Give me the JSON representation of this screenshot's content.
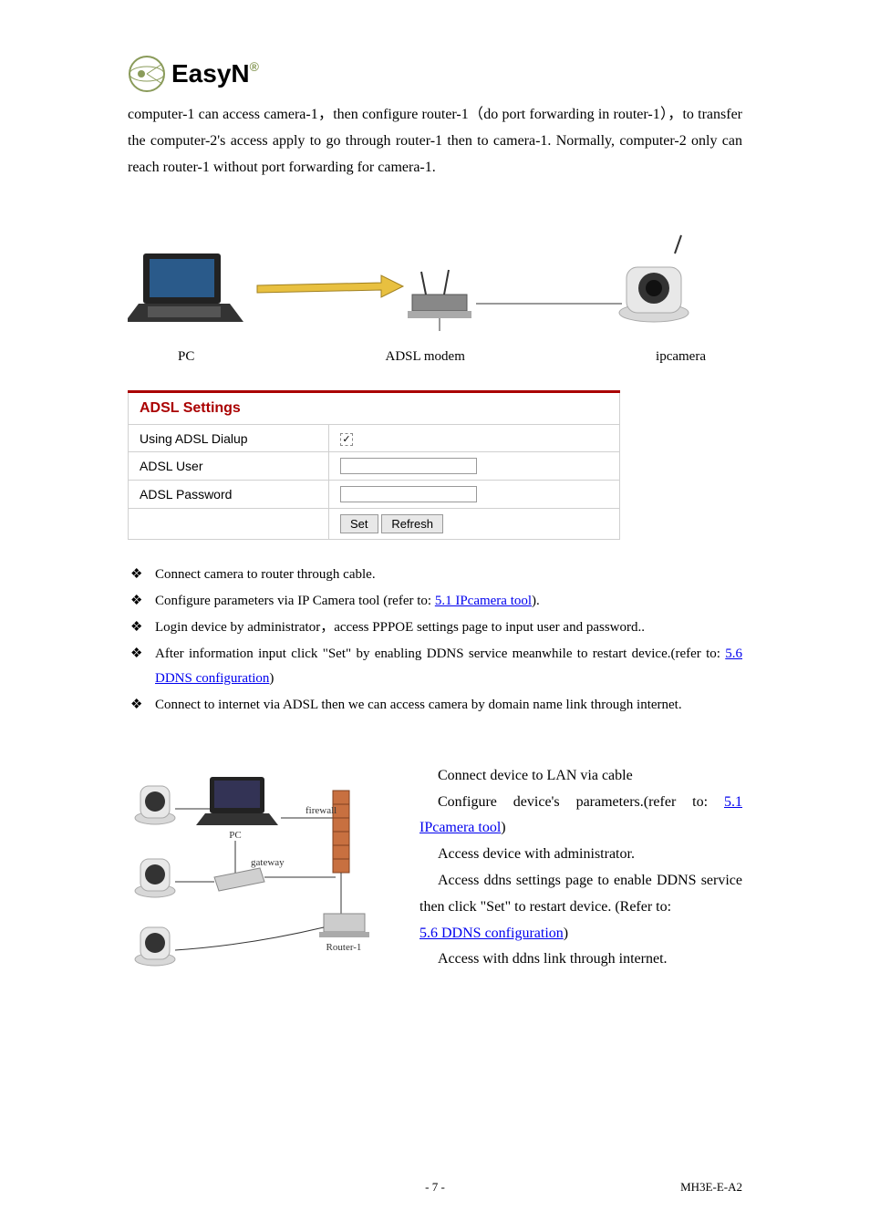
{
  "logo": {
    "brand": "EasyN",
    "registered": "®"
  },
  "intro_paragraph": "computer-1 can access camera-1，then configure router-1（do port forwarding in router-1），to transfer the computer-2's access apply to go through router-1 then to camera-1. Normally, computer-2 only can reach router-1 without port forwarding for camera-1.",
  "diagram1": {
    "pc_label": "PC",
    "modem_label": "ADSL modem",
    "camera_label": "ipcamera"
  },
  "adsl_table": {
    "title": "ADSL Settings",
    "rows": {
      "dialup_label": "Using ADSL Dialup",
      "user_label": "ADSL User",
      "password_label": "ADSL Password"
    },
    "buttons": {
      "set": "Set",
      "refresh": "Refresh"
    }
  },
  "bullets": [
    {
      "text": "Connect camera to router through cable."
    },
    {
      "prefix": "Configure parameters via IP Camera tool (refer to: ",
      "link": "5.1 IPcamera tool",
      "suffix": ")."
    },
    {
      "text": "Login device by administrator，access PPPOE settings page to input user and password.."
    },
    {
      "prefix": "After information input click \"Set\" by enabling DDNS service meanwhile to restart device.(refer to: ",
      "link": "5.6 DDNS configuration",
      "suffix": ")"
    },
    {
      "text": "Connect to internet via ADSL then we can access camera by domain name link through internet."
    }
  ],
  "diagram2": {
    "pc_label": "PC",
    "firewall_label": "firewall",
    "gateway_label": "gateway",
    "router_label": "Router-1"
  },
  "right_paragraphs": {
    "p1": "Connect device to LAN via cable",
    "p2_prefix": "Configure device's parameters.(refer to: ",
    "p2_link": "5.1 IPcamera tool",
    "p2_suffix": ")",
    "p3": "Access device with administrator.",
    "p4_prefix": "Access ddns settings page to enable DDNS service then click \"Set\" to restart device. (Refer to: ",
    "p4_link": "5.6 DDNS configuration",
    "p4_suffix": ")",
    "p5": "Access with ddns link through internet."
  },
  "footer": {
    "page_number": "- 7 -",
    "doc_ref": "MH3E-E-A2"
  }
}
